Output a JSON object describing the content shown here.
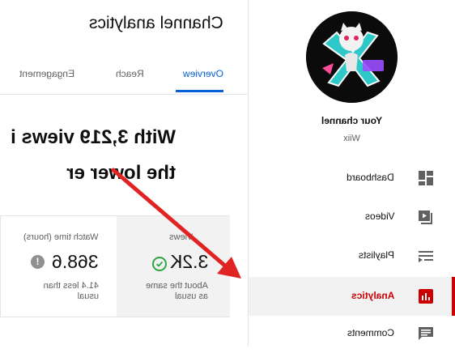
{
  "main": {
    "title": "Channel analytics",
    "tabs": [
      {
        "label": "Overview",
        "active": true
      },
      {
        "label": "Reach",
        "active": false
      },
      {
        "label": "Engagement",
        "active": false
      }
    ],
    "headline_line1": "With 3,219 views i",
    "headline_line2": "the lower er",
    "stats": {
      "views": {
        "label": "Views",
        "value": "3.2K",
        "note_line1": "About the same",
        "note_line2": "as usual"
      },
      "watch_time": {
        "label": "Watch time (hours)",
        "value": "368.6",
        "note_line1": "41.4 less than",
        "note_line2": "usual"
      }
    }
  },
  "sidebar": {
    "channel_title": "Your channel",
    "channel_name": "Wiix",
    "items": [
      {
        "label": "Dashboard",
        "icon": "dashboard-icon",
        "active": false
      },
      {
        "label": "Videos",
        "icon": "videos-icon",
        "active": false
      },
      {
        "label": "Playlists",
        "icon": "playlists-icon",
        "active": false
      },
      {
        "label": "Analytics",
        "icon": "analytics-icon",
        "active": true
      },
      {
        "label": "Comments",
        "icon": "comments-icon",
        "active": false
      }
    ]
  },
  "colors": {
    "accent": "#cc0000",
    "tab_blue": "#065fd4",
    "check_green": "#2ba640",
    "arrow_red": "#e02424"
  }
}
